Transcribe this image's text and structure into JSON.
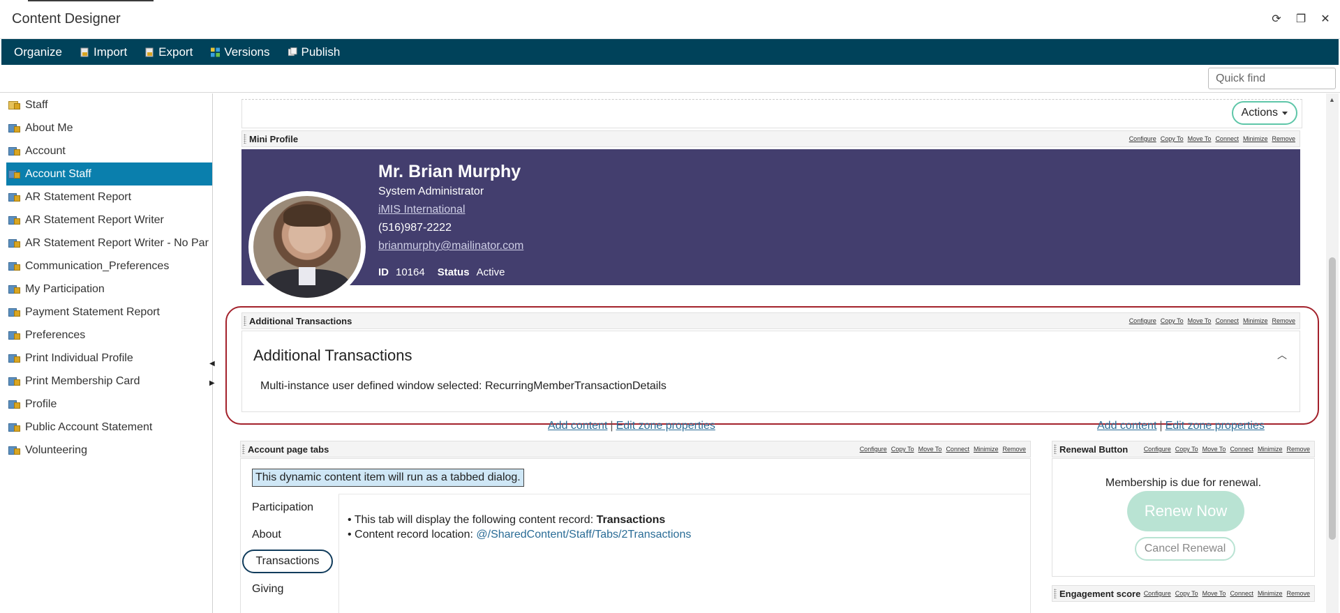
{
  "window": {
    "title": "Content Designer",
    "controls": {
      "refresh": "⟳",
      "restore": "❐",
      "close": "✕"
    }
  },
  "menu": {
    "items": [
      {
        "label": "Organize",
        "icon": ""
      },
      {
        "label": "Import",
        "icon": "import-icon"
      },
      {
        "label": "Export",
        "icon": "export-icon"
      },
      {
        "label": "Versions",
        "icon": "versions-icon"
      },
      {
        "label": "Publish",
        "icon": "publish-icon"
      }
    ],
    "colors": {
      "background": "#00425a"
    }
  },
  "quick_find": {
    "placeholder": "Quick find",
    "value": ""
  },
  "tree": {
    "items": [
      {
        "label": "Staff",
        "selected": false
      },
      {
        "label": "About Me",
        "selected": false
      },
      {
        "label": "Account",
        "selected": false
      },
      {
        "label": "Account Staff",
        "selected": true
      },
      {
        "label": "AR Statement Report",
        "selected": false
      },
      {
        "label": "AR Statement Report Writer",
        "selected": false
      },
      {
        "label": "AR Statement Report Writer - No Par",
        "selected": false
      },
      {
        "label": "Communication_Preferences",
        "selected": false
      },
      {
        "label": "My Participation",
        "selected": false
      },
      {
        "label": "Payment Statement Report",
        "selected": false
      },
      {
        "label": "Preferences",
        "selected": false
      },
      {
        "label": "Print Individual Profile",
        "selected": false
      },
      {
        "label": "Print Membership Card",
        "selected": false
      },
      {
        "label": "Profile",
        "selected": false
      },
      {
        "label": "Public Account Statement",
        "selected": false
      },
      {
        "label": "Volunteering",
        "selected": false
      }
    ],
    "colors": {
      "selected": "#0a7fad"
    }
  },
  "actions": {
    "label": "Actions"
  },
  "part_links": [
    "Configure",
    "Copy To",
    "Move To",
    "Connect",
    "Minimize",
    "Remove"
  ],
  "mini_profile": {
    "header": "Mini Profile",
    "name": "Mr. Brian Murphy",
    "title": "System Administrator",
    "organization": "iMIS International",
    "phone": "(516)987-2222",
    "email": "brianmurphy@mailinator.com",
    "id_label": "ID",
    "id_value": "10164",
    "status_label": "Status",
    "status_value": "Active",
    "colors": {
      "background": "#433e6e"
    }
  },
  "additional_transactions": {
    "header": "Additional Transactions",
    "title": "Additional Transactions",
    "message": "Multi-instance user defined window selected: RecurringMemberTransactionDetails",
    "highlight_color": "#a3212b"
  },
  "zone_links": {
    "add_content": "Add content",
    "separator": "|",
    "edit_zone": "Edit zone properties"
  },
  "account_tabs": {
    "header": "Account page tabs",
    "note": "This dynamic content item will run as a tabbed dialog.",
    "tabs": [
      {
        "label": "Participation",
        "active": false
      },
      {
        "label": "About",
        "active": false
      },
      {
        "label": "Transactions",
        "active": true
      },
      {
        "label": "Giving",
        "active": false
      }
    ],
    "body": {
      "line1_prefix": "• This tab will display the following content record: ",
      "line1_bold": "Transactions",
      "line2_prefix": "• Content record location: ",
      "line2_link": "@/SharedContent/Staff/Tabs/2Transactions"
    }
  },
  "renewal": {
    "header": "Renewal Button",
    "message": "Membership is due for renewal.",
    "renew_label": "Renew Now",
    "cancel_label": "Cancel Renewal",
    "colors": {
      "accent": "#b9e3d3"
    }
  },
  "engagement": {
    "header": "Engagement score"
  }
}
